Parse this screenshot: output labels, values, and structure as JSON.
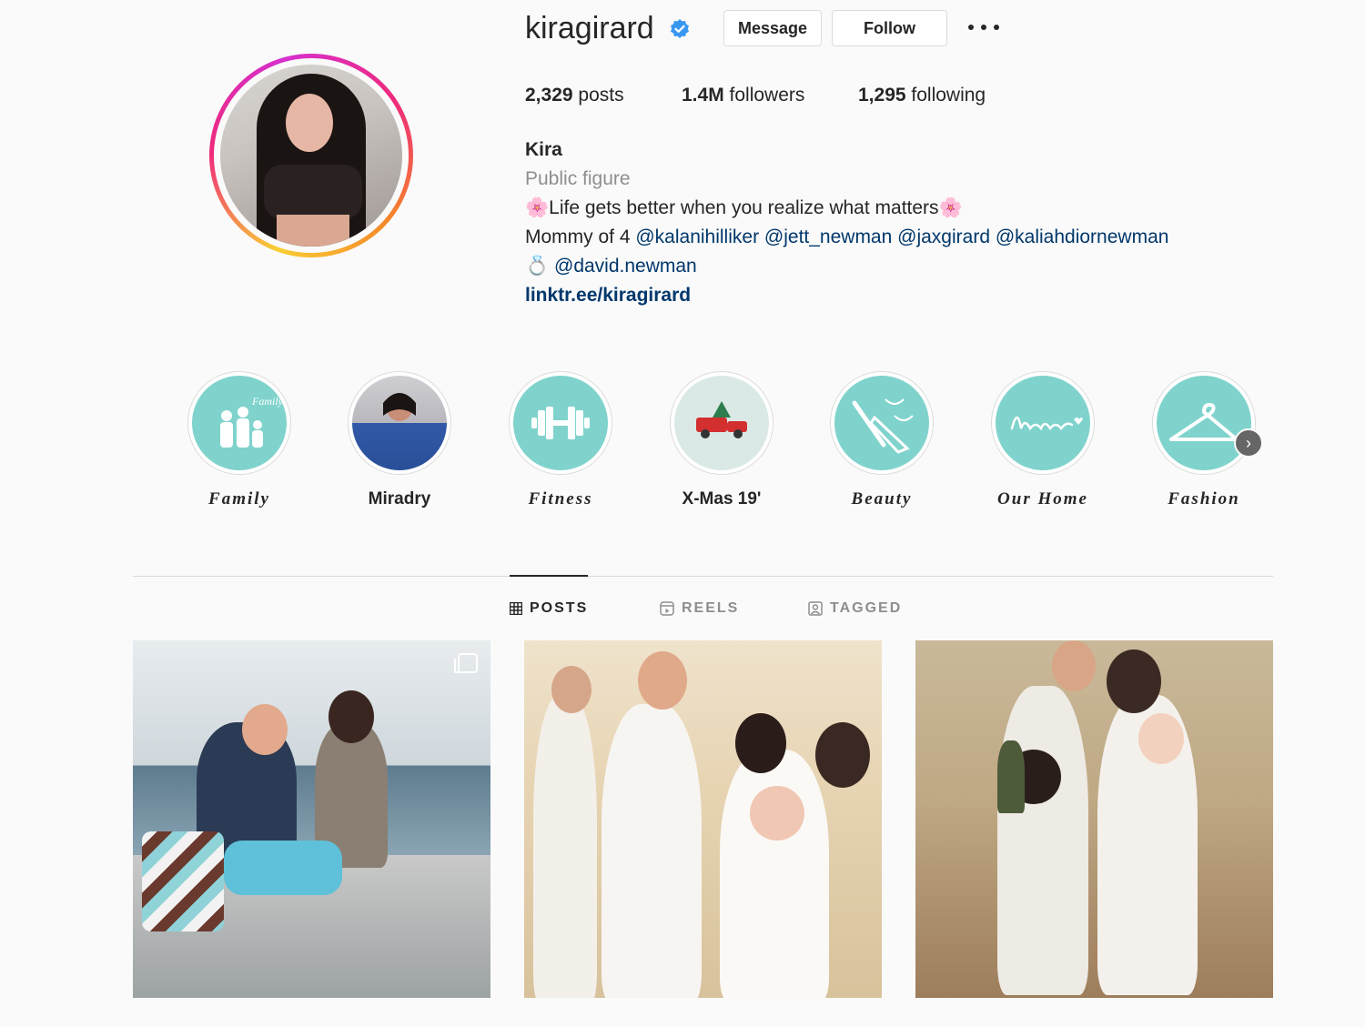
{
  "profile": {
    "username": "kiragirard",
    "verified": true,
    "message_label": "Message",
    "follow_label": "Follow",
    "stats": {
      "posts_count": "2,329",
      "posts_label": " posts",
      "followers_count": "1.4M",
      "followers_label": " followers",
      "following_count": "1,295",
      "following_label": " following"
    },
    "full_name": "Kira",
    "category": "Public figure",
    "bio": {
      "line1_emoji_left": "🌸",
      "line1_text": "Life gets better when you realize what matters",
      "line1_emoji_right": "🌸",
      "line2_prefix": "Mommy of 4 ",
      "line2_mentions": [
        "@kalanihilliker",
        "@jett_newman",
        "@jaxgirard",
        "@kaliahdiornewman"
      ],
      "line3_emoji": "💍",
      "line3_mention": "@david.newman"
    },
    "link": "linktr.ee/kiragirard"
  },
  "highlights": [
    {
      "label": "Family"
    },
    {
      "label": "Miradry"
    },
    {
      "label": "Fitness"
    },
    {
      "label": "X-Mas 19'"
    },
    {
      "label": "Beauty"
    },
    {
      "label": "Our Home"
    },
    {
      "label": "Fashion"
    }
  ],
  "tabs": {
    "posts": "POSTS",
    "reels": "REELS",
    "tagged": "TAGGED",
    "active": "posts"
  },
  "colors": {
    "highlight_teal": "#7fd3cc",
    "link_blue": "#00376b",
    "verified_blue": "#3897f0",
    "muted_gray": "#8e8e8e"
  }
}
